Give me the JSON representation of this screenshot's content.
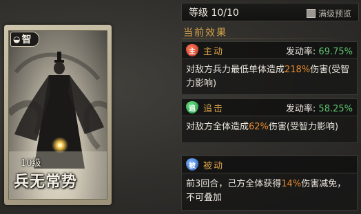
{
  "card": {
    "badge_icon": "mask-icon",
    "badge_label": "智",
    "level": "10级",
    "name": "兵无常势"
  },
  "header": {
    "level_text": "等级 10/10",
    "preview_label": "满级预览",
    "preview_checked": false
  },
  "section": {
    "title": "当前效果"
  },
  "skills": [
    {
      "tag_char": "主",
      "tag_name": "主动",
      "rate_label": "发动率: ",
      "rate_value": "69.75%",
      "desc_pre": "对敌方兵力最低单体造成",
      "desc_num": "218%",
      "desc_post": "伤害(受智力影响)"
    },
    {
      "tag_char": "追",
      "tag_name": "追击",
      "rate_label": "发动率: ",
      "rate_value": "58.25%",
      "desc_pre": "对敌方全体造成",
      "desc_num": "62%",
      "desc_post": "伤害(受智力影响)"
    },
    {
      "tag_char": "被",
      "tag_name": "被动",
      "desc_pre": "前3回合，己方全体获得",
      "desc_num": "14%",
      "desc_post": "伤害减免，不可叠加"
    }
  ],
  "colors": {
    "accent_gold": "#d9a24a",
    "rate_green": "#5ec26a",
    "highlight_orange": "#e98a2e",
    "active_red": "#c0301f",
    "pursuit_green": "#1f8f3a",
    "passive_blue": "#2756b3"
  }
}
